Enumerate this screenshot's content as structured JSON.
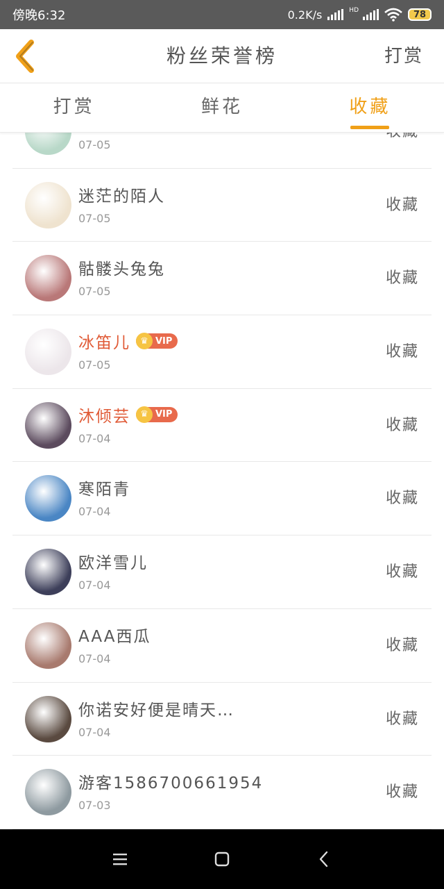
{
  "status_bar": {
    "time": "傍晚6:32",
    "speed": "0.2K/s",
    "hd": "HD",
    "battery": "78"
  },
  "header": {
    "title": "粉丝荣誉榜",
    "action": "打赏"
  },
  "tabs": [
    {
      "label": "打赏",
      "active": false
    },
    {
      "label": "鲜花",
      "active": false
    },
    {
      "label": "收藏",
      "active": true
    }
  ],
  "list": [
    {
      "name": "",
      "date": "07-05",
      "action": "收藏",
      "vip": false,
      "avatar_color": "#b8d8c8"
    },
    {
      "name": "迷茫的陌人",
      "date": "07-05",
      "action": "收藏",
      "vip": false,
      "avatar_color": "#efe3cf"
    },
    {
      "name": "骷髅头兔兔",
      "date": "07-05",
      "action": "收藏",
      "vip": false,
      "avatar_color": "#b97878"
    },
    {
      "name": "冰笛儿",
      "date": "07-05",
      "action": "收藏",
      "vip": true,
      "vip_label": "VIP",
      "avatar_color": "#ece6ea"
    },
    {
      "name": "沐倾芸",
      "date": "07-04",
      "action": "收藏",
      "vip": true,
      "vip_label": "VIP",
      "avatar_color": "#5c4b5e"
    },
    {
      "name": "寒陌青",
      "date": "07-04",
      "action": "收藏",
      "vip": false,
      "avatar_color": "#4a86c4"
    },
    {
      "name": "欧洋雪儿",
      "date": "07-04",
      "action": "收藏",
      "vip": false,
      "avatar_color": "#3d3f5a"
    },
    {
      "name": "AAA西瓜",
      "date": "07-04",
      "action": "收藏",
      "vip": false,
      "avatar_color": "#a87a6e"
    },
    {
      "name": "你诺安好便是晴天…",
      "date": "07-04",
      "action": "收藏",
      "vip": false,
      "avatar_color": "#5a4a40"
    },
    {
      "name": "游客1586700661954",
      "date": "07-03",
      "action": "收藏",
      "vip": false,
      "avatar_color": "#8e9aa0"
    }
  ],
  "nav": {
    "menu_icon": "menu-icon",
    "home_icon": "home-icon",
    "back_icon": "back-icon"
  }
}
